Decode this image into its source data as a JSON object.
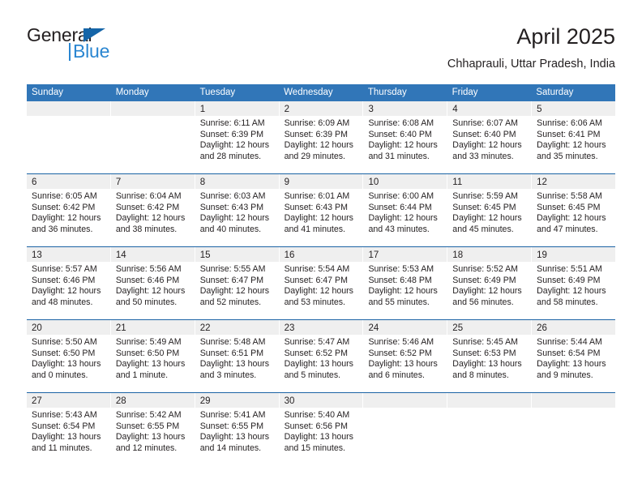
{
  "logo": {
    "word_top": "General",
    "word_bottom": "Blue",
    "triangle_color": "#1565a8",
    "blue_color": "#2a86d1"
  },
  "header": {
    "title": "April 2025",
    "subtitle": "Chhaprauli, Uttar Pradesh, India"
  },
  "colors": {
    "header_bar": "#3176b8",
    "row_divider": "#1b63a5",
    "day_band": "#efefef",
    "text": "#231f20"
  },
  "calendar": {
    "weekdays": [
      "Sunday",
      "Monday",
      "Tuesday",
      "Wednesday",
      "Thursday",
      "Friday",
      "Saturday"
    ],
    "weeks": [
      [
        {
          "day": "",
          "lines": []
        },
        {
          "day": "",
          "lines": []
        },
        {
          "day": "1",
          "lines": [
            "Sunrise: 6:11 AM",
            "Sunset: 6:39 PM",
            "Daylight: 12 hours",
            "and 28 minutes."
          ]
        },
        {
          "day": "2",
          "lines": [
            "Sunrise: 6:09 AM",
            "Sunset: 6:39 PM",
            "Daylight: 12 hours",
            "and 29 minutes."
          ]
        },
        {
          "day": "3",
          "lines": [
            "Sunrise: 6:08 AM",
            "Sunset: 6:40 PM",
            "Daylight: 12 hours",
            "and 31 minutes."
          ]
        },
        {
          "day": "4",
          "lines": [
            "Sunrise: 6:07 AM",
            "Sunset: 6:40 PM",
            "Daylight: 12 hours",
            "and 33 minutes."
          ]
        },
        {
          "day": "5",
          "lines": [
            "Sunrise: 6:06 AM",
            "Sunset: 6:41 PM",
            "Daylight: 12 hours",
            "and 35 minutes."
          ]
        }
      ],
      [
        {
          "day": "6",
          "lines": [
            "Sunrise: 6:05 AM",
            "Sunset: 6:42 PM",
            "Daylight: 12 hours",
            "and 36 minutes."
          ]
        },
        {
          "day": "7",
          "lines": [
            "Sunrise: 6:04 AM",
            "Sunset: 6:42 PM",
            "Daylight: 12 hours",
            "and 38 minutes."
          ]
        },
        {
          "day": "8",
          "lines": [
            "Sunrise: 6:03 AM",
            "Sunset: 6:43 PM",
            "Daylight: 12 hours",
            "and 40 minutes."
          ]
        },
        {
          "day": "9",
          "lines": [
            "Sunrise: 6:01 AM",
            "Sunset: 6:43 PM",
            "Daylight: 12 hours",
            "and 41 minutes."
          ]
        },
        {
          "day": "10",
          "lines": [
            "Sunrise: 6:00 AM",
            "Sunset: 6:44 PM",
            "Daylight: 12 hours",
            "and 43 minutes."
          ]
        },
        {
          "day": "11",
          "lines": [
            "Sunrise: 5:59 AM",
            "Sunset: 6:45 PM",
            "Daylight: 12 hours",
            "and 45 minutes."
          ]
        },
        {
          "day": "12",
          "lines": [
            "Sunrise: 5:58 AM",
            "Sunset: 6:45 PM",
            "Daylight: 12 hours",
            "and 47 minutes."
          ]
        }
      ],
      [
        {
          "day": "13",
          "lines": [
            "Sunrise: 5:57 AM",
            "Sunset: 6:46 PM",
            "Daylight: 12 hours",
            "and 48 minutes."
          ]
        },
        {
          "day": "14",
          "lines": [
            "Sunrise: 5:56 AM",
            "Sunset: 6:46 PM",
            "Daylight: 12 hours",
            "and 50 minutes."
          ]
        },
        {
          "day": "15",
          "lines": [
            "Sunrise: 5:55 AM",
            "Sunset: 6:47 PM",
            "Daylight: 12 hours",
            "and 52 minutes."
          ]
        },
        {
          "day": "16",
          "lines": [
            "Sunrise: 5:54 AM",
            "Sunset: 6:47 PM",
            "Daylight: 12 hours",
            "and 53 minutes."
          ]
        },
        {
          "day": "17",
          "lines": [
            "Sunrise: 5:53 AM",
            "Sunset: 6:48 PM",
            "Daylight: 12 hours",
            "and 55 minutes."
          ]
        },
        {
          "day": "18",
          "lines": [
            "Sunrise: 5:52 AM",
            "Sunset: 6:49 PM",
            "Daylight: 12 hours",
            "and 56 minutes."
          ]
        },
        {
          "day": "19",
          "lines": [
            "Sunrise: 5:51 AM",
            "Sunset: 6:49 PM",
            "Daylight: 12 hours",
            "and 58 minutes."
          ]
        }
      ],
      [
        {
          "day": "20",
          "lines": [
            "Sunrise: 5:50 AM",
            "Sunset: 6:50 PM",
            "Daylight: 13 hours",
            "and 0 minutes."
          ]
        },
        {
          "day": "21",
          "lines": [
            "Sunrise: 5:49 AM",
            "Sunset: 6:50 PM",
            "Daylight: 13 hours",
            "and 1 minute."
          ]
        },
        {
          "day": "22",
          "lines": [
            "Sunrise: 5:48 AM",
            "Sunset: 6:51 PM",
            "Daylight: 13 hours",
            "and 3 minutes."
          ]
        },
        {
          "day": "23",
          "lines": [
            "Sunrise: 5:47 AM",
            "Sunset: 6:52 PM",
            "Daylight: 13 hours",
            "and 5 minutes."
          ]
        },
        {
          "day": "24",
          "lines": [
            "Sunrise: 5:46 AM",
            "Sunset: 6:52 PM",
            "Daylight: 13 hours",
            "and 6 minutes."
          ]
        },
        {
          "day": "25",
          "lines": [
            "Sunrise: 5:45 AM",
            "Sunset: 6:53 PM",
            "Daylight: 13 hours",
            "and 8 minutes."
          ]
        },
        {
          "day": "26",
          "lines": [
            "Sunrise: 5:44 AM",
            "Sunset: 6:54 PM",
            "Daylight: 13 hours",
            "and 9 minutes."
          ]
        }
      ],
      [
        {
          "day": "27",
          "lines": [
            "Sunrise: 5:43 AM",
            "Sunset: 6:54 PM",
            "Daylight: 13 hours",
            "and 11 minutes."
          ]
        },
        {
          "day": "28",
          "lines": [
            "Sunrise: 5:42 AM",
            "Sunset: 6:55 PM",
            "Daylight: 13 hours",
            "and 12 minutes."
          ]
        },
        {
          "day": "29",
          "lines": [
            "Sunrise: 5:41 AM",
            "Sunset: 6:55 PM",
            "Daylight: 13 hours",
            "and 14 minutes."
          ]
        },
        {
          "day": "30",
          "lines": [
            "Sunrise: 5:40 AM",
            "Sunset: 6:56 PM",
            "Daylight: 13 hours",
            "and 15 minutes."
          ]
        },
        {
          "day": "",
          "lines": []
        },
        {
          "day": "",
          "lines": []
        },
        {
          "day": "",
          "lines": []
        }
      ]
    ]
  }
}
